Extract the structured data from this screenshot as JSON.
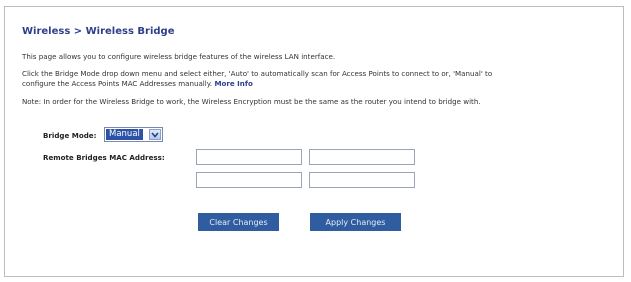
{
  "breadcrumb": "Wireless > Wireless Bridge",
  "description": "This page allows you to configure wireless bridge features of the wireless LAN interface.",
  "instructions_line1": "Click the Bridge Mode drop down menu and select either, 'Auto' to automatically scan for Access Points to connect to or, 'Manual' to",
  "instructions_line2": "configure the Access Points MAC Addresses manually.",
  "more_info_link": "More Info",
  "note": "Note: In order for the Wireless Bridge to work, the Wireless Encryption must be the same as the router you intend to bridge with.",
  "bridge_mode": {
    "label": "Bridge Mode:",
    "selected": "Manual"
  },
  "mac": {
    "label": "Remote Bridges MAC Address:",
    "fields": [
      "",
      "",
      "",
      ""
    ]
  },
  "buttons": {
    "clear": "Clear Changes",
    "apply": "Apply Changes"
  },
  "colors": {
    "heading": "#2d3f8a",
    "button_bg": "#2f5d9f",
    "select_highlight": "#2d53a8"
  },
  "icons": {
    "dropdown": "chevron-down-icon"
  }
}
